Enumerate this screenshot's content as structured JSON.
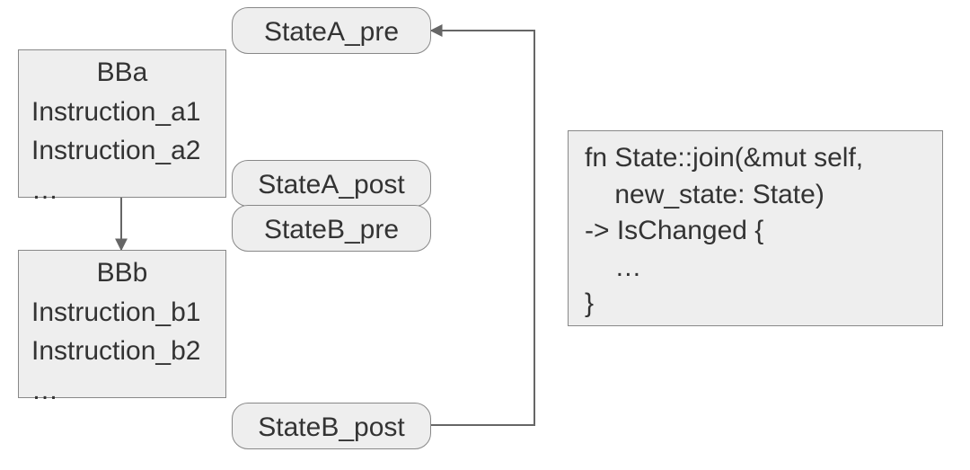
{
  "bba": {
    "title": "BBa",
    "instr1": "Instruction_a1",
    "instr2": "Instruction_a2",
    "more": "…"
  },
  "bbb": {
    "title": "BBb",
    "instr1": "Instruction_b1",
    "instr2": "Instruction_b2",
    "more": "…"
  },
  "states": {
    "a_pre": "StateA_pre",
    "a_post": "StateA_post",
    "b_pre": "StateB_pre",
    "b_post": "StateB_post"
  },
  "codebox": {
    "line1": "fn State::join(&mut self,",
    "line2": "    new_state: State)",
    "line3": "-> IsChanged {",
    "line4": "    …",
    "line5": "}"
  }
}
